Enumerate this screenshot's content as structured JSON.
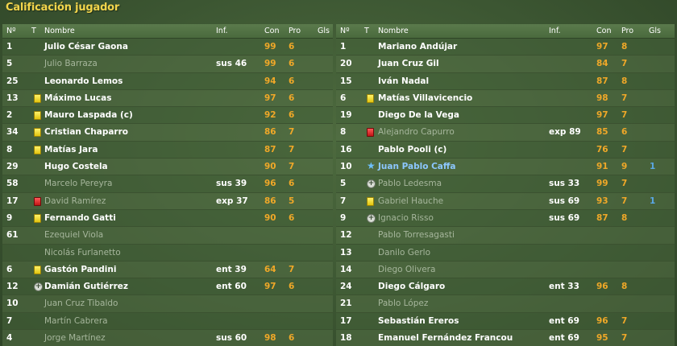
{
  "title": "Calificación jugador",
  "headers": {
    "num": "Nº",
    "t": "T",
    "name": "Nombre",
    "inf": "Inf.",
    "con": "Con",
    "pro": "Pro",
    "gls": "Gls"
  },
  "colors": {
    "title": "#f2d54c",
    "rating": "#f0a828",
    "goals": "#5aa8e6",
    "dim_name": "#a6b69c",
    "star_name": "#8cc7ff"
  },
  "left_rows": [
    {
      "num": "1",
      "icon": "",
      "name": "Julio César Gaona",
      "inf": "",
      "con": "99",
      "pro": "6",
      "gls": "",
      "dim": false
    },
    {
      "num": "5",
      "icon": "",
      "name": "Julio Barraza",
      "inf": "sus 46",
      "con": "99",
      "pro": "6",
      "gls": "",
      "dim": true
    },
    {
      "num": "25",
      "icon": "",
      "name": "Leonardo Lemos",
      "inf": "",
      "con": "94",
      "pro": "6",
      "gls": "",
      "dim": false
    },
    {
      "num": "13",
      "icon": "yellow-card-icon",
      "name": "Máximo Lucas",
      "inf": "",
      "con": "97",
      "pro": "6",
      "gls": "",
      "dim": false
    },
    {
      "num": "2",
      "icon": "yellow-card-icon",
      "name": "Mauro Laspada (c)",
      "inf": "",
      "con": "92",
      "pro": "6",
      "gls": "",
      "dim": false
    },
    {
      "num": "34",
      "icon": "yellow-card-icon",
      "name": "Cristian Chaparro",
      "inf": "",
      "con": "86",
      "pro": "7",
      "gls": "",
      "dim": false
    },
    {
      "num": "8",
      "icon": "yellow-card-icon",
      "name": "Matías Jara",
      "inf": "",
      "con": "87",
      "pro": "7",
      "gls": "",
      "dim": false
    },
    {
      "num": "29",
      "icon": "",
      "name": "Hugo Costela",
      "inf": "",
      "con": "90",
      "pro": "7",
      "gls": "",
      "dim": false
    },
    {
      "num": "58",
      "icon": "",
      "name": "Marcelo Pereyra",
      "inf": "sus 39",
      "con": "96",
      "pro": "6",
      "gls": "",
      "dim": true
    },
    {
      "num": "17",
      "icon": "red-card-icon",
      "name": "David Ramírez",
      "inf": "exp 37",
      "con": "86",
      "pro": "5",
      "gls": "",
      "dim": true
    },
    {
      "num": "9",
      "icon": "yellow-card-icon",
      "name": "Fernando Gatti",
      "inf": "",
      "con": "90",
      "pro": "6",
      "gls": "",
      "dim": false
    },
    {
      "num": "61",
      "icon": "",
      "name": "Ezequiel Viola",
      "inf": "",
      "con": "",
      "pro": "",
      "gls": "",
      "dim": true
    },
    {
      "num": "",
      "icon": "",
      "name": "Nicolás Furlanetto",
      "inf": "",
      "con": "",
      "pro": "",
      "gls": "",
      "dim": true
    },
    {
      "num": "6",
      "icon": "yellow-card-icon",
      "name": "Gastón Pandini",
      "inf": "ent 39",
      "con": "64",
      "pro": "7",
      "gls": "",
      "dim": false
    },
    {
      "num": "12",
      "icon": "plus-icon",
      "name": "Damián Gutiérrez",
      "inf": "ent 60",
      "con": "97",
      "pro": "6",
      "gls": "",
      "dim": false
    },
    {
      "num": "10",
      "icon": "",
      "name": "Juan Cruz Tibaldo",
      "inf": "",
      "con": "",
      "pro": "",
      "gls": "",
      "dim": true
    },
    {
      "num": "7",
      "icon": "",
      "name": "Martín Cabrera",
      "inf": "",
      "con": "",
      "pro": "",
      "gls": "",
      "dim": true
    },
    {
      "num": "4",
      "icon": "",
      "name": "Jorge Martínez",
      "inf": "sus 60",
      "con": "98",
      "pro": "6",
      "gls": "",
      "dim": true
    }
  ],
  "right_rows": [
    {
      "num": "1",
      "icon": "",
      "name": "Mariano Andújar",
      "inf": "",
      "con": "97",
      "pro": "8",
      "gls": "",
      "dim": false
    },
    {
      "num": "20",
      "icon": "",
      "name": "Juan Cruz Gil",
      "inf": "",
      "con": "84",
      "pro": "7",
      "gls": "",
      "dim": false
    },
    {
      "num": "15",
      "icon": "",
      "name": "Iván Nadal",
      "inf": "",
      "con": "87",
      "pro": "8",
      "gls": "",
      "dim": false
    },
    {
      "num": "6",
      "icon": "yellow-card-icon",
      "name": "Matías Villavicencio",
      "inf": "",
      "con": "98",
      "pro": "7",
      "gls": "",
      "dim": false
    },
    {
      "num": "19",
      "icon": "",
      "name": "Diego De la Vega",
      "inf": "",
      "con": "97",
      "pro": "7",
      "gls": "",
      "dim": false
    },
    {
      "num": "8",
      "icon": "red-card-icon",
      "name": "Alejandro Capurro",
      "inf": "exp 89",
      "con": "85",
      "pro": "6",
      "gls": "",
      "dim": true
    },
    {
      "num": "16",
      "icon": "",
      "name": "Pablo Pooli (c)",
      "inf": "",
      "con": "76",
      "pro": "7",
      "gls": "",
      "dim": false
    },
    {
      "num": "10",
      "icon": "star-icon",
      "name": "Juan Pablo Caffa",
      "inf": "",
      "con": "91",
      "pro": "9",
      "gls": "1",
      "dim": false,
      "star": true
    },
    {
      "num": "5",
      "icon": "plus-icon",
      "name": "Pablo Ledesma",
      "inf": "sus 33",
      "con": "99",
      "pro": "7",
      "gls": "",
      "dim": true
    },
    {
      "num": "7",
      "icon": "yellow-card-icon",
      "name": "Gabriel Hauche",
      "inf": "sus 69",
      "con": "93",
      "pro": "7",
      "gls": "1",
      "dim": true
    },
    {
      "num": "9",
      "icon": "plus-icon",
      "name": "Ignacio Risso",
      "inf": "sus 69",
      "con": "87",
      "pro": "8",
      "gls": "",
      "dim": true
    },
    {
      "num": "12",
      "icon": "",
      "name": "Pablo Torresagasti",
      "inf": "",
      "con": "",
      "pro": "",
      "gls": "",
      "dim": true
    },
    {
      "num": "13",
      "icon": "",
      "name": "Danilo Gerlo",
      "inf": "",
      "con": "",
      "pro": "",
      "gls": "",
      "dim": true
    },
    {
      "num": "14",
      "icon": "",
      "name": "Diego Olivera",
      "inf": "",
      "con": "",
      "pro": "",
      "gls": "",
      "dim": true
    },
    {
      "num": "24",
      "icon": "",
      "name": "Diego Cálgaro",
      "inf": "ent 33",
      "con": "96",
      "pro": "8",
      "gls": "",
      "dim": false
    },
    {
      "num": "21",
      "icon": "",
      "name": "Pablo López",
      "inf": "",
      "con": "",
      "pro": "",
      "gls": "",
      "dim": true
    },
    {
      "num": "17",
      "icon": "",
      "name": "Sebastián Ereros",
      "inf": "ent 69",
      "con": "96",
      "pro": "7",
      "gls": "",
      "dim": false
    },
    {
      "num": "18",
      "icon": "",
      "name": "Emanuel Fernández Francou",
      "inf": "ent 69",
      "con": "95",
      "pro": "7",
      "gls": "",
      "dim": false
    }
  ]
}
